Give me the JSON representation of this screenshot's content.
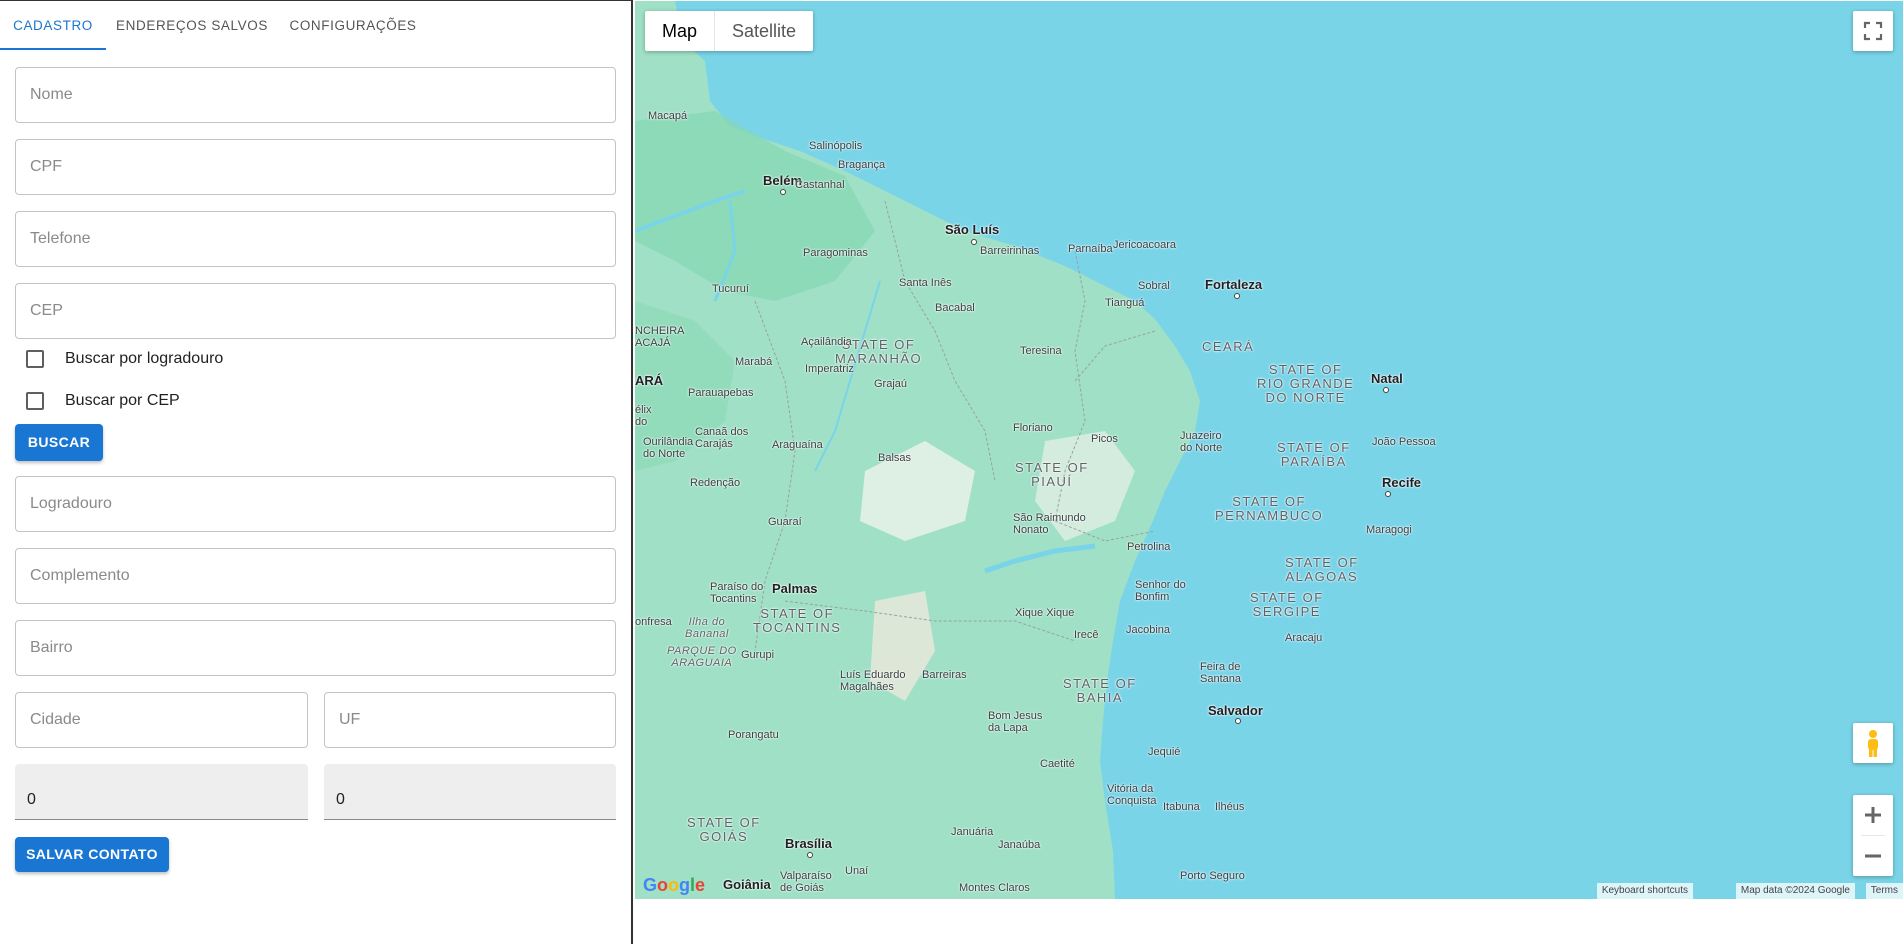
{
  "tabs": [
    {
      "label": "CADASTRO",
      "active": true
    },
    {
      "label": "ENDEREÇOS SALVOS",
      "active": false
    },
    {
      "label": "CONFIGURAÇÕES",
      "active": false
    }
  ],
  "form": {
    "nome_placeholder": "Nome",
    "cpf_placeholder": "CPF",
    "telefone_placeholder": "Telefone",
    "cep_placeholder": "CEP",
    "check_logradouro": "Buscar por logradouro",
    "check_cep": "Buscar por CEP",
    "buscar_label": "BUSCAR",
    "logradouro_placeholder": "Logradouro",
    "complemento_placeholder": "Complemento",
    "bairro_placeholder": "Bairro",
    "cidade_placeholder": "Cidade",
    "uf_placeholder": "UF",
    "latitude_value": "0",
    "longitude_value": "0",
    "salvar_label": "SALVAR CONTATO"
  },
  "map": {
    "type_map": "Map",
    "type_satellite": "Satellite",
    "google_logo": "Google",
    "keyboard_shortcuts": "Keyboard shortcuts",
    "map_data": "Map data ©2024 Google",
    "terms": "Terms",
    "colors": {
      "water": "#7ad4e8",
      "land": "#9fe0c6",
      "accent": "#1976d2"
    },
    "cities": {
      "fortaleza": "Fortaleza",
      "natal": "Natal",
      "recife": "Recife",
      "salvador": "Salvador",
      "sao_luis": "São Luís",
      "belem": "Belém",
      "brasilia": "Brasília",
      "goiania": "Goiânia",
      "palmas": "Palmas",
      "teresina": "Teresina",
      "joao_pessoa": "João Pessoa",
      "aracaju": "Aracaju",
      "maceio": "Maragogi",
      "macapa": "Macapá",
      "maraba": "Marabá",
      "imperatriz": "Imperatriz",
      "feira": "Feira de\nSantana",
      "juazeiro": "Juazeiro\ndo Norte",
      "petrolina": "Petrolina",
      "montes_claros": "Montes Claros",
      "porto_seguro": "Porto Seguro",
      "vitoria_conquista": "Vitória da\nConquista",
      "barreiras": "Barreiras",
      "parauapebas": "Parauapebas",
      "araguaina": "Araguaína",
      "balsas": "Balsas",
      "floriano": "Floriano",
      "picos": "Picos",
      "sobral": "Sobral",
      "parnaiba": "Parnaíba",
      "jericoacoara": "Jericoacoara",
      "tiangua": "Tianguá",
      "bacabal": "Bacabal",
      "santa_ines": "Santa Inês",
      "barreirinhas": "Barreirinhas",
      "paragominas": "Paragominas",
      "castanhal": "Castanhal",
      "braganca": "Bragança",
      "salinopolis": "Salinópolis",
      "tucurui": "Tucuruí",
      "acailandia": "Açailândia",
      "grajau": "Grajaú",
      "caneos": "Canaã dos\nCarajás",
      "ourilandia": "Ourilândia\ndo Norte",
      "redencao": "Redenção",
      "guarai": "Guaraí",
      "paraiso": "Paraíso do\nTocantins",
      "gurupi": "Gurupi",
      "luis_eduardo": "Luís Eduardo\nMagalhães",
      "bom_jesus": "Bom Jesus\nda Lapa",
      "caetite": "Caetité",
      "jequie": "Jequié",
      "itabuna": "Itabuna",
      "ilheus": "Ilhéus",
      "irece": "Irecê",
      "jacobina": "Jacobina",
      "senhor_bonfim": "Senhor do\nBonfim",
      "xique": "Xique Xique",
      "sao_raimundo": "São Raimundo\nNonato",
      "porangatu": "Porangatu",
      "januaria": "Januária",
      "janauba": "Janaúba",
      "valparaiso": "Valparaíso\nde Goiás",
      "unai": "Unaí",
      "confresa": "onfresa",
      "cheira": "NCHEIRA\nACAJÁ",
      "para_frag": "ARÁ",
      "felix": "élix\ndo"
    },
    "states": {
      "maranhao": "STATE OF\nMARANHÃO",
      "ceara": "CEARÁ",
      "rn": "STATE OF\nRIO GRANDE\nDO NORTE",
      "paraiba": "STATE OF\nPARAÍBA",
      "pernambuco": "STATE OF\nPERNAMBUCO",
      "alagoas": "STATE OF\nALAGOAS",
      "sergipe": "STATE OF\nSERGIPE",
      "piaui": "STATE OF\nPIAUÍ",
      "bahia": "STATE OF\nBAHIA",
      "tocantins": "STATE OF\nTOCANTINS",
      "goias": "STATE OF\nGOIÁS"
    },
    "regions": {
      "ilha": "Ilha do\nBananal",
      "parque": "PARQUE DO\nARAGUAIA"
    }
  }
}
